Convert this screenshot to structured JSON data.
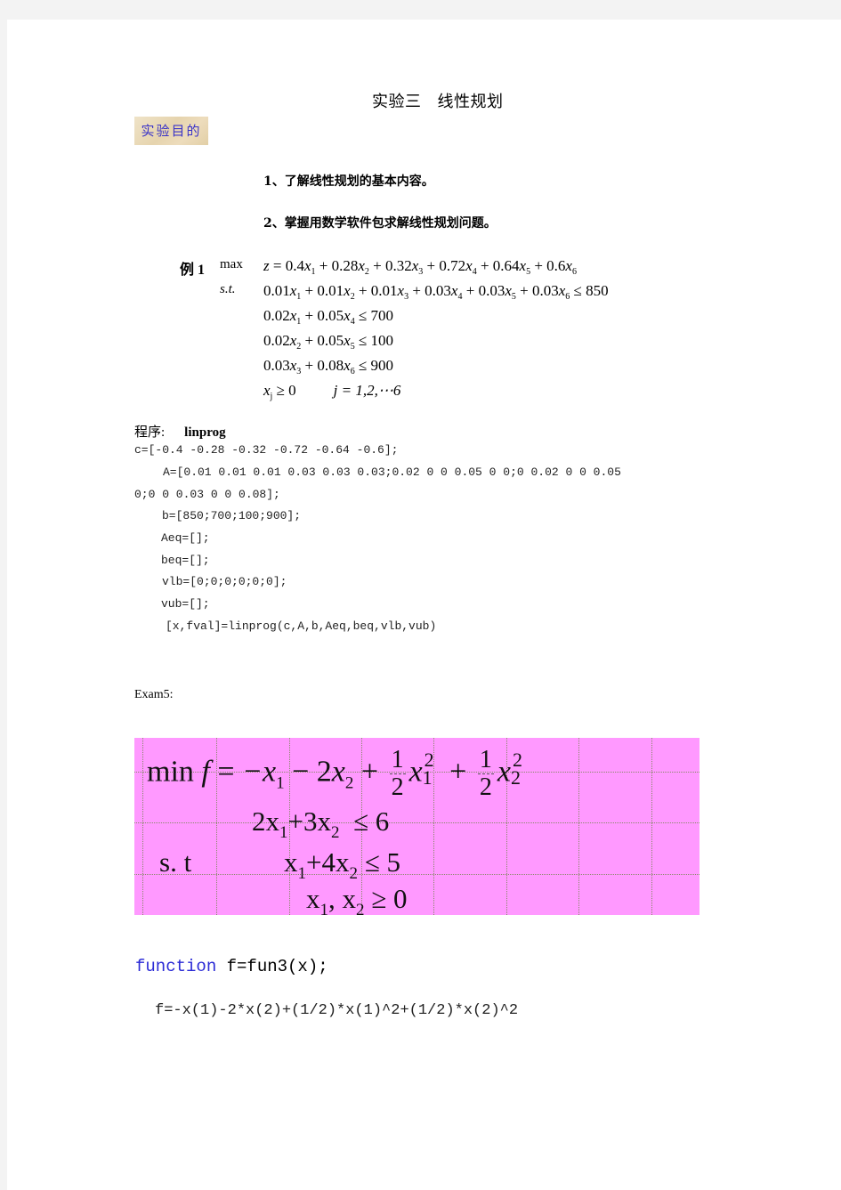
{
  "title": {
    "part1": "实验三",
    "part2": "线性规划"
  },
  "section_label": "实验目的",
  "goals": [
    "1、了解线性规划的基本内容。",
    "2、掌握用数学软件包求解线性规划问题。"
  ],
  "example1": {
    "label": "例 1",
    "objective_keyword": "max",
    "st_keyword": "s.t.",
    "objective": {
      "lhs": "z",
      "terms": [
        {
          "coef": "0.4",
          "var": "x",
          "idx": "1"
        },
        {
          "coef": "0.28",
          "var": "x",
          "idx": "2"
        },
        {
          "coef": "0.32",
          "var": "x",
          "idx": "3"
        },
        {
          "coef": "0.72",
          "var": "x",
          "idx": "4"
        },
        {
          "coef": "0.64",
          "var": "x",
          "idx": "5"
        },
        {
          "coef": "0.6",
          "var": "x",
          "idx": "6"
        }
      ]
    },
    "constraints": [
      {
        "terms": [
          {
            "coef": "0.01",
            "idx": "1"
          },
          {
            "coef": "0.01",
            "idx": "2"
          },
          {
            "coef": "0.01",
            "idx": "3"
          },
          {
            "coef": "0.03",
            "idx": "4"
          },
          {
            "coef": "0.03",
            "idx": "5"
          },
          {
            "coef": "0.03",
            "idx": "6"
          }
        ],
        "op": "≤",
        "rhs": "850"
      },
      {
        "terms": [
          {
            "coef": "0.02",
            "idx": "1"
          },
          {
            "coef": "0.05",
            "idx": "4"
          }
        ],
        "op": "≤",
        "rhs": "700"
      },
      {
        "terms": [
          {
            "coef": "0.02",
            "idx": "2"
          },
          {
            "coef": "0.05",
            "idx": "5"
          }
        ],
        "op": "≤",
        "rhs": "100"
      },
      {
        "terms": [
          {
            "coef": "0.03",
            "idx": "3"
          },
          {
            "coef": "0.08",
            "idx": "6"
          }
        ],
        "op": "≤",
        "rhs": "900"
      }
    ],
    "nonneg": {
      "var": "x",
      "idx": "j",
      "op": "≥",
      "rhs": "0",
      "range": "j = 1,2,⋯6"
    }
  },
  "program": {
    "label": "程序:",
    "name": "linprog",
    "lines": [
      "c=[-0.4 -0.28 -0.32 -0.72 -0.64 -0.6];",
      "A=[0.01 0.01 0.01 0.03 0.03 0.03;0.02 0 0 0.05 0 0;0 0.02 0 0 0.05",
      "0;0 0 0.03 0 0 0.08];",
      "b=[850;700;100;900];",
      "Aeq=[];",
      "beq=[];",
      "vlb=[0;0;0;0;0;0];",
      "vub=[];",
      "[x,fval]=linprog(c,A,b,Aeq,beq,vlb,vub)"
    ]
  },
  "exam5": {
    "label": "Exam5:",
    "background": "#ff99ff",
    "objective": {
      "keyword": "min",
      "lhs": "f",
      "eq": "=",
      "t1": "−x",
      "t1_idx": "1",
      "op2": "−",
      "t2_coef": "2",
      "t2_var": "x",
      "t2_idx": "2",
      "op3": "+",
      "frac_num": "1",
      "frac_den": "2",
      "t3_var": "x",
      "t3_idx": "1",
      "t3_pow": "2",
      "op4": "+",
      "t4_var": "x",
      "t4_idx": "2",
      "t4_pow": "2"
    },
    "st_keyword": "s. t",
    "constraints": [
      {
        "lhs_a": "2x",
        "a_idx": "1",
        "mid": "+3x",
        "b_idx": "2",
        "op": "≤",
        "rhs": "6"
      },
      {
        "lhs_a": "x",
        "a_idx": "1",
        "mid": "+4x",
        "b_idx": "2",
        "op": "≤",
        "rhs": "5"
      },
      {
        "lhs_a": "x",
        "a_idx": "1",
        "mid": ", x",
        "b_idx": "2",
        "op": "≥",
        "rhs": "0"
      }
    ]
  },
  "function_code": {
    "keyword": "function",
    "signature": " f=fun3(x);",
    "body": "f=-x(1)-2*x(2)+(1/2)*x(1)^2+(1/2)*x(2)^2",
    "keyword_color": "#2b2bd6"
  }
}
